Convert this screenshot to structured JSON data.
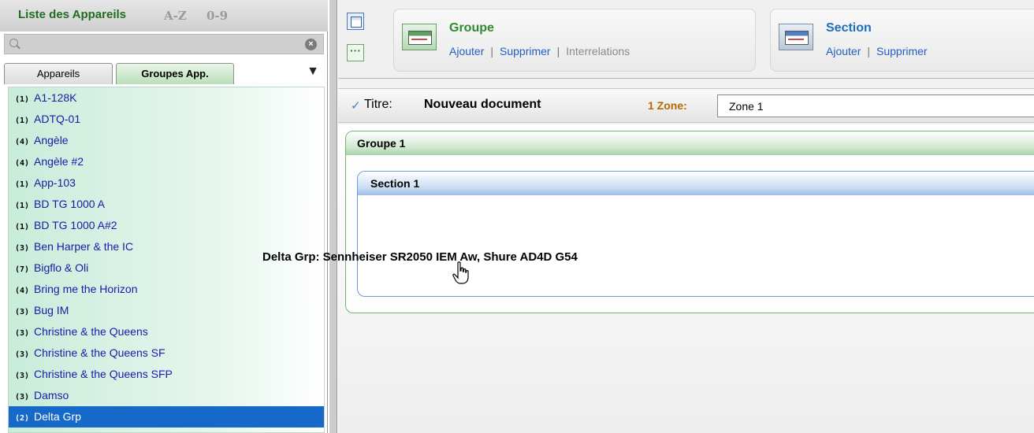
{
  "left_panel": {
    "title": "Liste des Appareils",
    "sort_az": "A-Z",
    "sort_09": "0-9",
    "search": {
      "value": "",
      "placeholder": ""
    },
    "tabs": [
      {
        "label": "Appareils",
        "active": false
      },
      {
        "label": "Groupes App.",
        "active": true
      }
    ],
    "items": [
      {
        "count": "(1)",
        "name": "A1-128K"
      },
      {
        "count": "(1)",
        "name": "ADTQ-01"
      },
      {
        "count": "(4)",
        "name": "Angèle"
      },
      {
        "count": "(4)",
        "name": "Angèle #2"
      },
      {
        "count": "(1)",
        "name": "App-103"
      },
      {
        "count": "(1)",
        "name": "BD TG 1000 A"
      },
      {
        "count": "(1)",
        "name": "BD TG 1000 A#2"
      },
      {
        "count": "(3)",
        "name": "Ben Harper & the IC"
      },
      {
        "count": "(7)",
        "name": "Bigflo & Oli"
      },
      {
        "count": "(4)",
        "name": "Bring me the Horizon"
      },
      {
        "count": "(3)",
        "name": "Bug IM"
      },
      {
        "count": "(3)",
        "name": "Christine & the Queens"
      },
      {
        "count": "(3)",
        "name": "Christine & the Queens SF"
      },
      {
        "count": "(3)",
        "name": "Christine & the Queens SFP"
      },
      {
        "count": "(3)",
        "name": "Damso"
      },
      {
        "count": "(2)",
        "name": "Delta Grp",
        "selected": true
      }
    ]
  },
  "toolbar": {
    "groupe": {
      "title": "Groupe",
      "add": "Ajouter",
      "delete": "Supprimer",
      "relations": "Interrelations"
    },
    "section": {
      "title": "Section",
      "add": "Ajouter",
      "delete": "Supprimer"
    }
  },
  "document": {
    "titre_label": "Titre:",
    "titre_value": "Nouveau document",
    "zone_label": "1 Zone:",
    "zone_value": "Zone 1"
  },
  "workspace": {
    "group_label": "Groupe 1",
    "section_label": "Section 1"
  },
  "drag_tooltip": "Delta Grp: Sennheiser SR2050 IEM Aw, Shure AD4D G54",
  "colors": {
    "selected_row": "#1769c9",
    "item_text": "#1a1aa8",
    "group_border": "#6fb56f",
    "section_border": "#6b9bd8",
    "zone_label": "#b36b00"
  }
}
